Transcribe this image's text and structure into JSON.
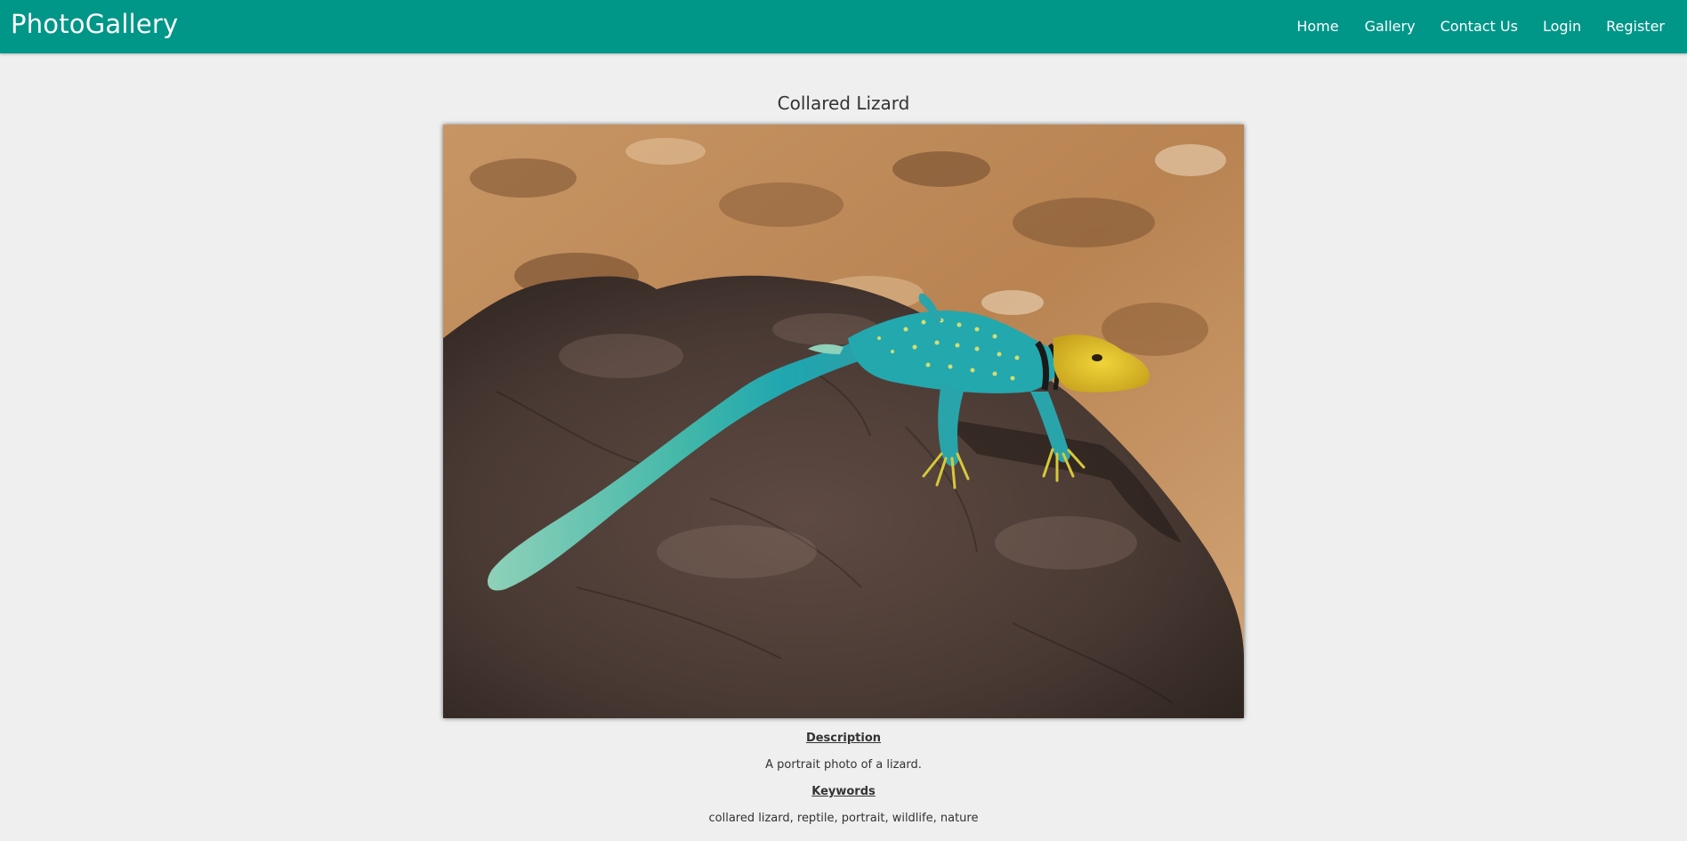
{
  "app": {
    "brand": "PhotoGallery",
    "accent_color": "#009688",
    "background_color": "#efefef"
  },
  "nav": {
    "home": "Home",
    "gallery": "Gallery",
    "contact": "Contact Us",
    "login": "Login",
    "register": "Register"
  },
  "photo": {
    "title": "Collared Lizard",
    "image_alt": "Collared Lizard",
    "description_label": "Description",
    "description": "A portrait photo of a lizard.",
    "keywords_label": "Keywords",
    "keywords": "collared lizard, reptile, portrait, wildlife, nature"
  }
}
